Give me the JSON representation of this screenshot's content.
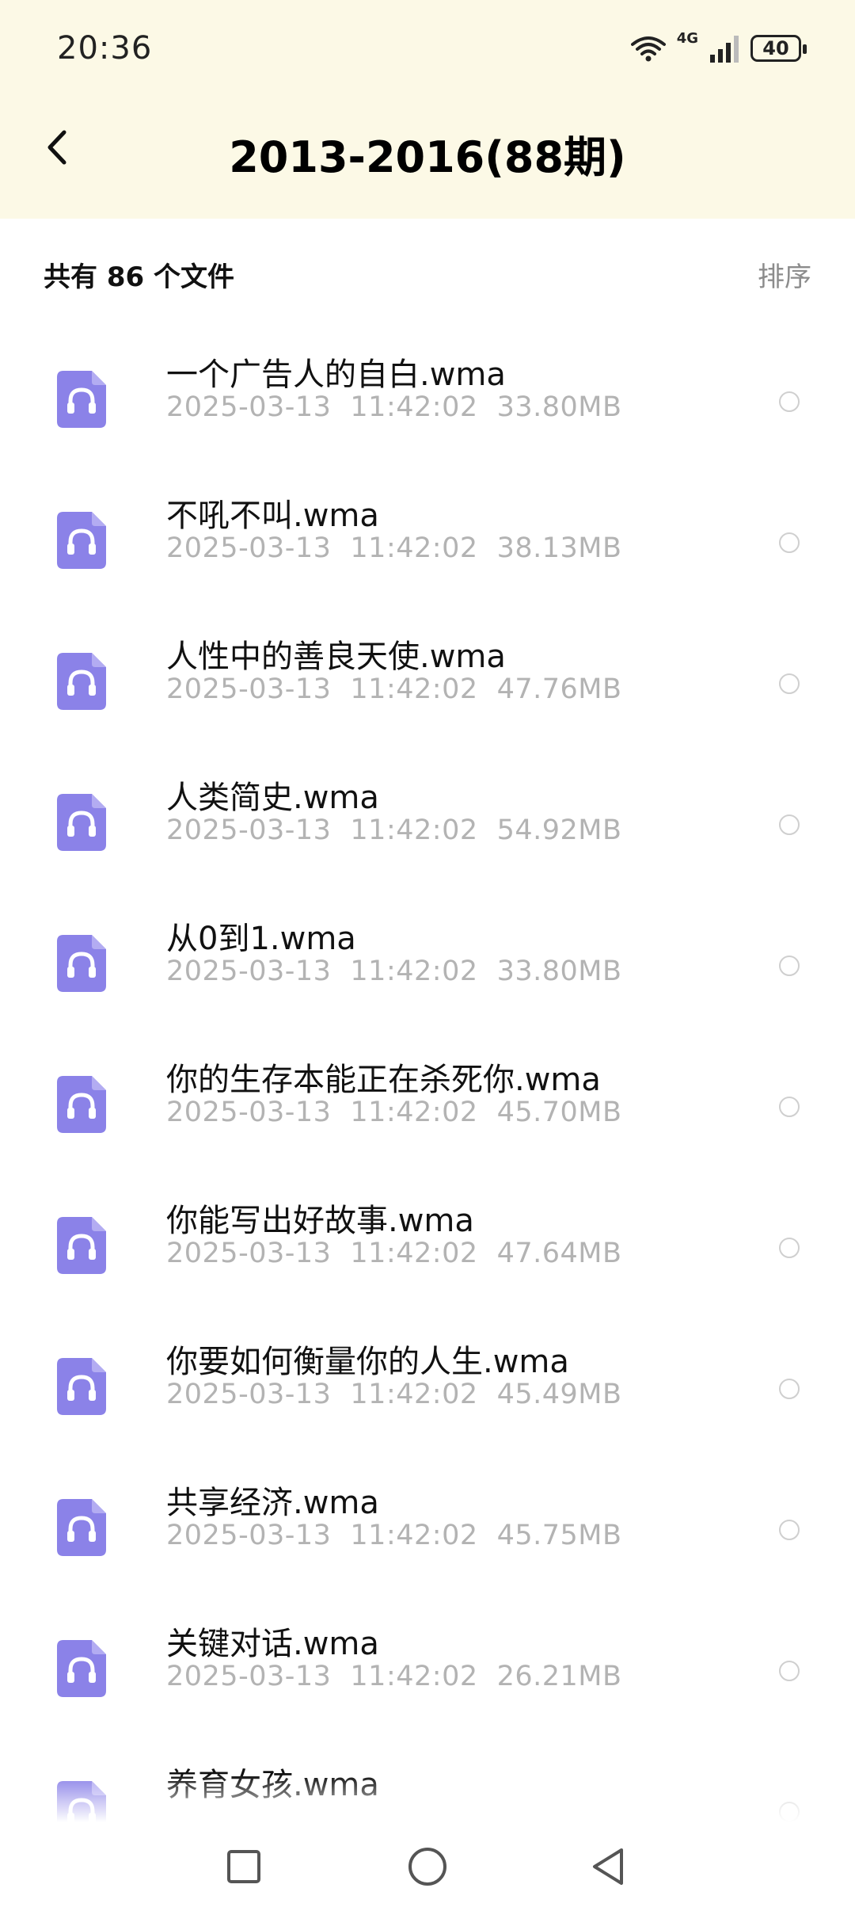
{
  "status_bar": {
    "time": "20:36",
    "network": "4G",
    "battery": "40",
    "icons": [
      "wifi-icon",
      "signal-icon",
      "battery-icon"
    ]
  },
  "title_bar": {
    "title": "2013-2016(88期)",
    "back_icon": "chevron-left-icon"
  },
  "sub_header": {
    "file_count": "共有 86 个文件",
    "sort_label": "排序"
  },
  "colors": {
    "header_bg": "#fcf9e6",
    "icon_purple": "#8b82e8",
    "meta_gray": "#b3b3b3"
  },
  "files": [
    {
      "name": "一个广告人的自白.wma",
      "date": "2025-03-13",
      "time": "11:42:02",
      "size": "33.80MB"
    },
    {
      "name": "不吼不叫.wma",
      "date": "2025-03-13",
      "time": "11:42:02",
      "size": "38.13MB"
    },
    {
      "name": "人性中的善良天使.wma",
      "date": "2025-03-13",
      "time": "11:42:02",
      "size": "47.76MB"
    },
    {
      "name": "人类简史.wma",
      "date": "2025-03-13",
      "time": "11:42:02",
      "size": "54.92MB"
    },
    {
      "name": "从0到1.wma",
      "date": "2025-03-13",
      "time": "11:42:02",
      "size": "33.80MB"
    },
    {
      "name": "你的生存本能正在杀死你.wma",
      "date": "2025-03-13",
      "time": "11:42:02",
      "size": "45.70MB"
    },
    {
      "name": "你能写出好故事.wma",
      "date": "2025-03-13",
      "time": "11:42:02",
      "size": "47.64MB"
    },
    {
      "name": "你要如何衡量你的人生.wma",
      "date": "2025-03-13",
      "time": "11:42:02",
      "size": "45.49MB"
    },
    {
      "name": "共享经济.wma",
      "date": "2025-03-13",
      "time": "11:42:02",
      "size": "45.75MB"
    },
    {
      "name": "关键对话.wma",
      "date": "2025-03-13",
      "time": "11:42:02",
      "size": "26.21MB"
    },
    {
      "name": "养育女孩.wma",
      "date": "",
      "time": "",
      "size": ""
    }
  ],
  "nav_bar": {
    "icons": [
      "recents-square-icon",
      "home-circle-icon",
      "back-triangle-icon"
    ]
  }
}
